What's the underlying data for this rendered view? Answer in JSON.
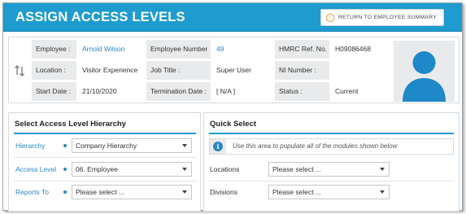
{
  "header": {
    "title": "ASSIGN ACCESS LEVELS",
    "return_button": "RETURN TO EMPLOYEE SUMMARY",
    "accent_color": "#1e9bcf"
  },
  "employee": {
    "rows": [
      [
        {
          "label": "Employee :",
          "value": "Arnold Wilson",
          "link": true
        },
        {
          "label": "Employee Number :",
          "value": "49",
          "link": true
        },
        {
          "label": "HMRC Ref. No. :",
          "value": "H09086468",
          "link": false
        }
      ],
      [
        {
          "label": "Location :",
          "value": "Visitor Experience",
          "link": false
        },
        {
          "label": "Job Title :",
          "value": "Super User",
          "link": false
        },
        {
          "label": "NI Number :",
          "value": "",
          "link": false
        }
      ],
      [
        {
          "label": "Start Date :",
          "value": "21/10/2020",
          "link": false
        },
        {
          "label": "Termination Date :",
          "value": "[ N/A ]",
          "link": false
        },
        {
          "label": "Status :",
          "value": "Current",
          "link": false
        }
      ]
    ],
    "avatar_icon": "person-silhouette-icon"
  },
  "hierarchy_panel": {
    "title": "Select Access Level Hierarchy",
    "fields": [
      {
        "label": "Hierarchy",
        "value": "Company Hierarchy"
      },
      {
        "label": "Access Level",
        "value": "06. Employee"
      },
      {
        "label": "Reports To",
        "value": "Please select ..."
      }
    ]
  },
  "quick_select": {
    "title": "Quick Select",
    "info_text": "Use this area to populate all of the modules shown below",
    "fields": [
      {
        "label": "Locations",
        "value": "Please select ..."
      },
      {
        "label": "Divisions",
        "value": "Please select ..."
      }
    ]
  }
}
